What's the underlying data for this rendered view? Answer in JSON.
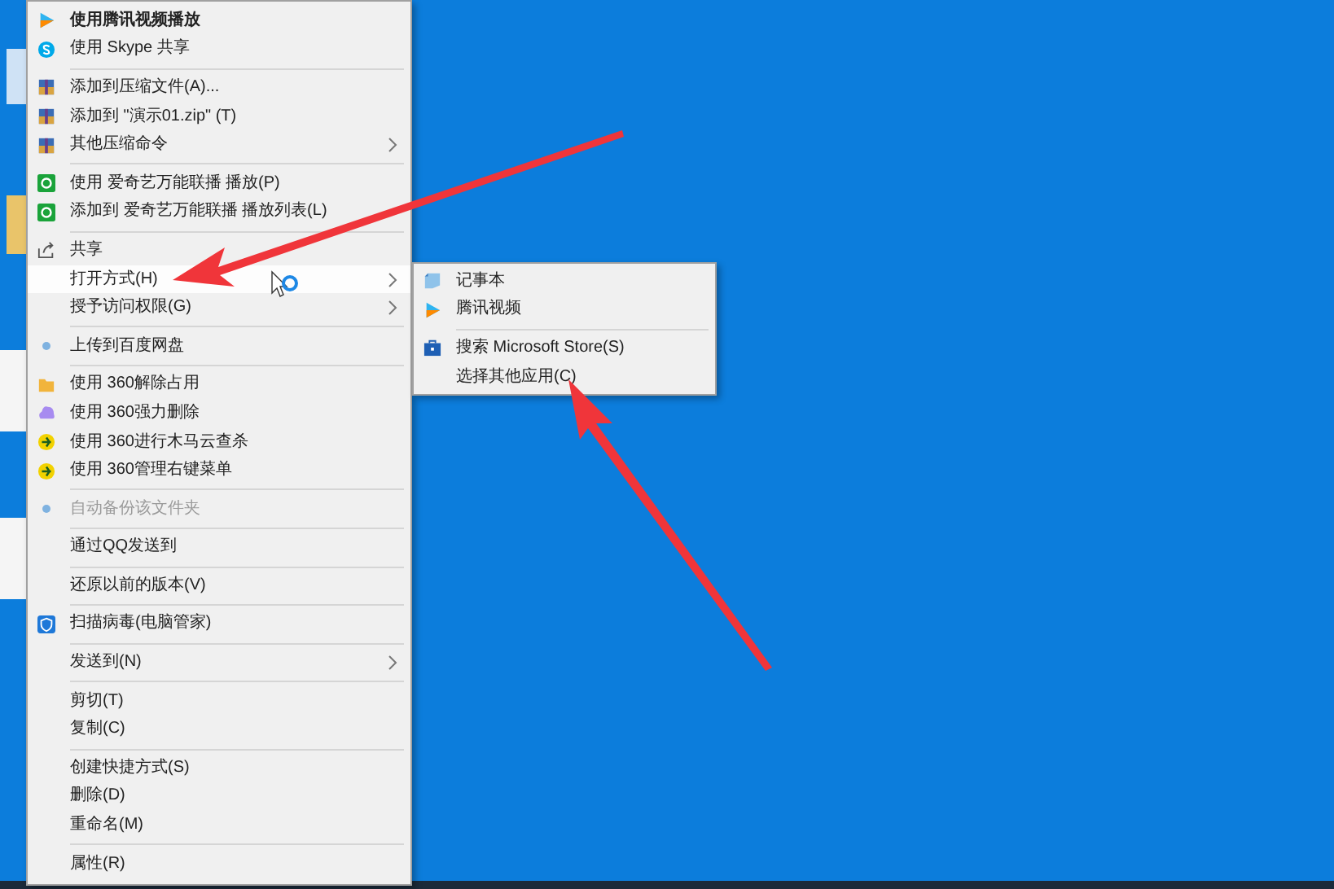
{
  "context_menu": {
    "items": [
      {
        "kind": "item",
        "label": "使用腾讯视频播放",
        "default": true,
        "submenu": false,
        "selected": false,
        "disabled": false
      },
      {
        "kind": "item",
        "label": "使用 Skype 共享",
        "default": false,
        "submenu": false,
        "selected": false,
        "disabled": false
      },
      {
        "kind": "separator"
      },
      {
        "kind": "item",
        "label": "添加到压缩文件(A)...",
        "default": false,
        "submenu": false,
        "selected": false,
        "disabled": false
      },
      {
        "kind": "item",
        "label": "添加到 \"演示01.zip\" (T)",
        "default": false,
        "submenu": false,
        "selected": false,
        "disabled": false
      },
      {
        "kind": "item",
        "label": "其他压缩命令",
        "default": false,
        "submenu": true,
        "selected": false,
        "disabled": false
      },
      {
        "kind": "separator"
      },
      {
        "kind": "item",
        "label": "使用 爱奇艺万能联播 播放(P)",
        "default": false,
        "submenu": false,
        "selected": false,
        "disabled": false
      },
      {
        "kind": "item",
        "label": "添加到 爱奇艺万能联播 播放列表(L)",
        "default": false,
        "submenu": false,
        "selected": false,
        "disabled": false
      },
      {
        "kind": "separator"
      },
      {
        "kind": "item",
        "label": "共享",
        "default": false,
        "submenu": false,
        "selected": false,
        "disabled": false
      },
      {
        "kind": "item",
        "label": "打开方式(H)",
        "default": false,
        "submenu": true,
        "selected": true,
        "disabled": false
      },
      {
        "kind": "item",
        "label": "授予访问权限(G)",
        "default": false,
        "submenu": true,
        "selected": false,
        "disabled": false
      },
      {
        "kind": "separator"
      },
      {
        "kind": "item",
        "label": "上传到百度网盘",
        "default": false,
        "submenu": false,
        "selected": false,
        "disabled": false
      },
      {
        "kind": "separator"
      },
      {
        "kind": "item",
        "label": "使用 360解除占用",
        "default": false,
        "submenu": false,
        "selected": false,
        "disabled": false
      },
      {
        "kind": "item",
        "label": "使用 360强力删除",
        "default": false,
        "submenu": false,
        "selected": false,
        "disabled": false
      },
      {
        "kind": "item",
        "label": "使用 360进行木马云查杀",
        "default": false,
        "submenu": false,
        "selected": false,
        "disabled": false
      },
      {
        "kind": "item",
        "label": "使用 360管理右键菜单",
        "default": false,
        "submenu": false,
        "selected": false,
        "disabled": false
      },
      {
        "kind": "separator"
      },
      {
        "kind": "item",
        "label": "自动备份该文件夹",
        "default": false,
        "submenu": false,
        "selected": false,
        "disabled": true
      },
      {
        "kind": "separator"
      },
      {
        "kind": "item",
        "label": "通过QQ发送到",
        "default": false,
        "submenu": false,
        "selected": false,
        "disabled": false
      },
      {
        "kind": "separator"
      },
      {
        "kind": "item",
        "label": "还原以前的版本(V)",
        "default": false,
        "submenu": false,
        "selected": false,
        "disabled": false
      },
      {
        "kind": "separator"
      },
      {
        "kind": "item",
        "label": "扫描病毒(电脑管家)",
        "default": false,
        "submenu": false,
        "selected": false,
        "disabled": false
      },
      {
        "kind": "separator"
      },
      {
        "kind": "item",
        "label": "发送到(N)",
        "default": false,
        "submenu": true,
        "selected": false,
        "disabled": false
      },
      {
        "kind": "separator"
      },
      {
        "kind": "item",
        "label": "剪切(T)",
        "default": false,
        "submenu": false,
        "selected": false,
        "disabled": false
      },
      {
        "kind": "item",
        "label": "复制(C)",
        "default": false,
        "submenu": false,
        "selected": false,
        "disabled": false
      },
      {
        "kind": "separator"
      },
      {
        "kind": "item",
        "label": "创建快捷方式(S)",
        "default": false,
        "submenu": false,
        "selected": false,
        "disabled": false
      },
      {
        "kind": "item",
        "label": "删除(D)",
        "default": false,
        "submenu": false,
        "selected": false,
        "disabled": false
      },
      {
        "kind": "item",
        "label": "重命名(M)",
        "default": false,
        "submenu": false,
        "selected": false,
        "disabled": false
      },
      {
        "kind": "separator"
      },
      {
        "kind": "item",
        "label": "属性(R)",
        "default": false,
        "submenu": false,
        "selected": false,
        "disabled": false
      }
    ]
  },
  "open_with_submenu": {
    "items": [
      {
        "kind": "item",
        "label": "记事本"
      },
      {
        "kind": "item",
        "label": "腾讯视频"
      },
      {
        "kind": "separator"
      },
      {
        "kind": "item",
        "label": "搜索 Microsoft Store(S)"
      },
      {
        "kind": "item",
        "label": "选择其他应用(C)"
      }
    ]
  }
}
